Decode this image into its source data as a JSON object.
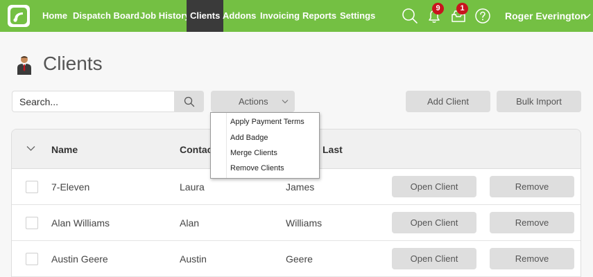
{
  "nav": {
    "items": [
      {
        "label": "Home"
      },
      {
        "label": "Dispatch Board"
      },
      {
        "label": "Job History"
      },
      {
        "label": "Clients"
      },
      {
        "label": "Addons"
      },
      {
        "label": "Invoicing"
      },
      {
        "label": "Reports"
      },
      {
        "label": "Settings"
      }
    ],
    "active": "Clients",
    "notifications_count": "9",
    "messages_count": "1",
    "user_name": "Roger Everington",
    "colors": {
      "bar": "#74c043",
      "active": "#3a3a3a",
      "badge": "#c8141e"
    }
  },
  "page": {
    "title": "Clients"
  },
  "toolbar": {
    "search_placeholder": "Search...",
    "actions_label": "Actions",
    "add_client_label": "Add Client",
    "bulk_import_label": "Bulk Import"
  },
  "actions_menu": {
    "items": [
      "Apply Payment Terms",
      "Add Badge",
      "Merge Clients",
      "Remove Clients"
    ]
  },
  "table": {
    "headers": {
      "name": "Name",
      "contact_first": "Contac",
      "contact_last": "Last"
    },
    "rows": [
      {
        "name": "7-Eleven",
        "first": "Laura",
        "last": "James"
      },
      {
        "name": "Alan Williams",
        "first": "Alan",
        "last": "Williams"
      },
      {
        "name": "Austin Geere",
        "first": "Austin",
        "last": "Geere"
      }
    ],
    "open_label": "Open Client",
    "remove_label": "Remove"
  }
}
